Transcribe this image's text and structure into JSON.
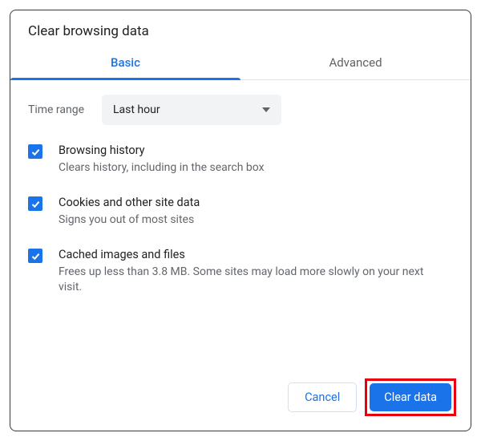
{
  "dialog": {
    "title": "Clear browsing data"
  },
  "tabs": {
    "basic": "Basic",
    "advanced": "Advanced"
  },
  "timeRange": {
    "label": "Time range",
    "value": "Last hour"
  },
  "options": {
    "history": {
      "title": "Browsing history",
      "desc": "Clears history, including in the search box"
    },
    "cookies": {
      "title": "Cookies and other site data",
      "desc": "Signs you out of most sites"
    },
    "cache": {
      "title": "Cached images and files",
      "desc": "Frees up less than 3.8 MB. Some sites may load more slowly on your next visit."
    }
  },
  "buttons": {
    "cancel": "Cancel",
    "clear": "Clear data"
  }
}
